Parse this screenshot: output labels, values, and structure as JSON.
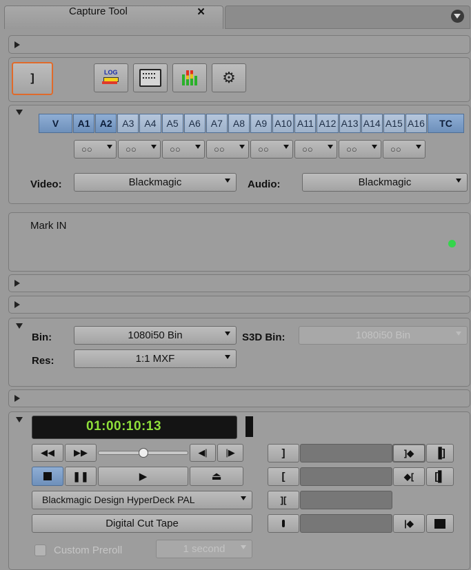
{
  "tab": {
    "title": "Capture Tool",
    "close": "×"
  },
  "toolbar": {
    "log_label": "LOG"
  },
  "tracks": [
    "V",
    "A1",
    "A2",
    "A3",
    "A4",
    "A5",
    "A6",
    "A7",
    "A8",
    "A9",
    "A10",
    "A11",
    "A12",
    "A13",
    "A14",
    "A15",
    "A16",
    "TC"
  ],
  "tracks_selected": [
    "V",
    "A1",
    "A2",
    "TC"
  ],
  "audio_channel_selectors": [
    "○○",
    "○○",
    "○○",
    "○○",
    "○○",
    "○○",
    "○○",
    "○○"
  ],
  "inputs": {
    "video_label": "Video:",
    "video_value": "Blackmagic",
    "audio_label": "Audio:",
    "audio_value": "Blackmagic"
  },
  "messages": {
    "text": "Mark IN",
    "status_color": "#34d54b"
  },
  "bins": {
    "bin_label": "Bin:",
    "bin_value": "1080i50 Bin",
    "s3d_label": "S3D Bin:",
    "s3d_value": "1080i50 Bin",
    "res_label": "Res:",
    "res_value": "1:1  MXF"
  },
  "deck": {
    "timecode": "01:00:10:13",
    "timecode_color": "#8fe03a",
    "shuttle_level": 0.5,
    "deck_name": "Blackmagic Design HyperDeck PAL",
    "digital_cut_label": "Digital Cut Tape",
    "custom_preroll_label": "Custom Preroll",
    "custom_preroll_checked": false,
    "preroll_value": "1 second"
  }
}
